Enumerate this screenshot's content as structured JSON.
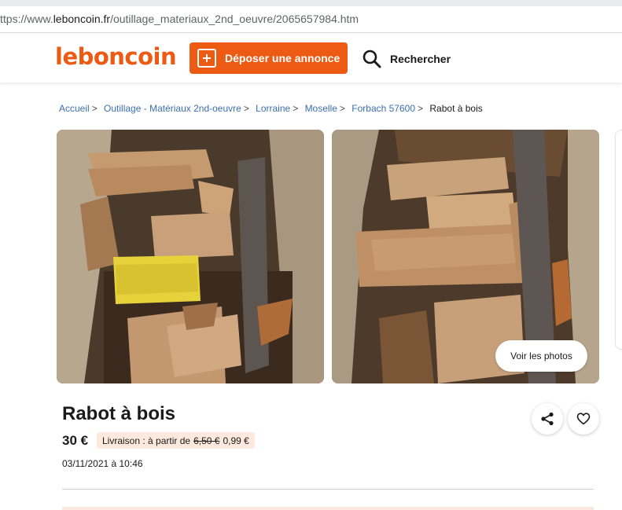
{
  "browser": {
    "url_prefix": "ttps://www.",
    "url_host": "leboncoin.fr",
    "url_path": "/outillage_materiaux_2nd_oeuvre/2065657984.htm"
  },
  "header": {
    "logo": "leboncoin",
    "post_ad_label": "Déposer une annonce",
    "search_label": "Rechercher",
    "brand_color": "#ec5a13"
  },
  "breadcrumb": {
    "items": [
      {
        "label": "Accueil"
      },
      {
        "label": "Outillage - Matériaux 2nd-oeuvre"
      },
      {
        "label": "Lorraine"
      },
      {
        "label": "Moselle"
      },
      {
        "label": "Forbach 57600"
      }
    ],
    "current": "Rabot à bois"
  },
  "gallery": {
    "see_photos_label": "Voir les photos"
  },
  "listing": {
    "title": "Rabot à bois",
    "price": "30 €",
    "delivery_prefix": "Livraison : à partir de",
    "delivery_old_price": "6,50 €",
    "delivery_price": "0,99 €",
    "date": "03/11/2021 à 10:46"
  },
  "icons": {
    "plus": "plus-square-icon",
    "search": "search-icon",
    "share": "share-icon",
    "favorite": "heart-icon"
  }
}
